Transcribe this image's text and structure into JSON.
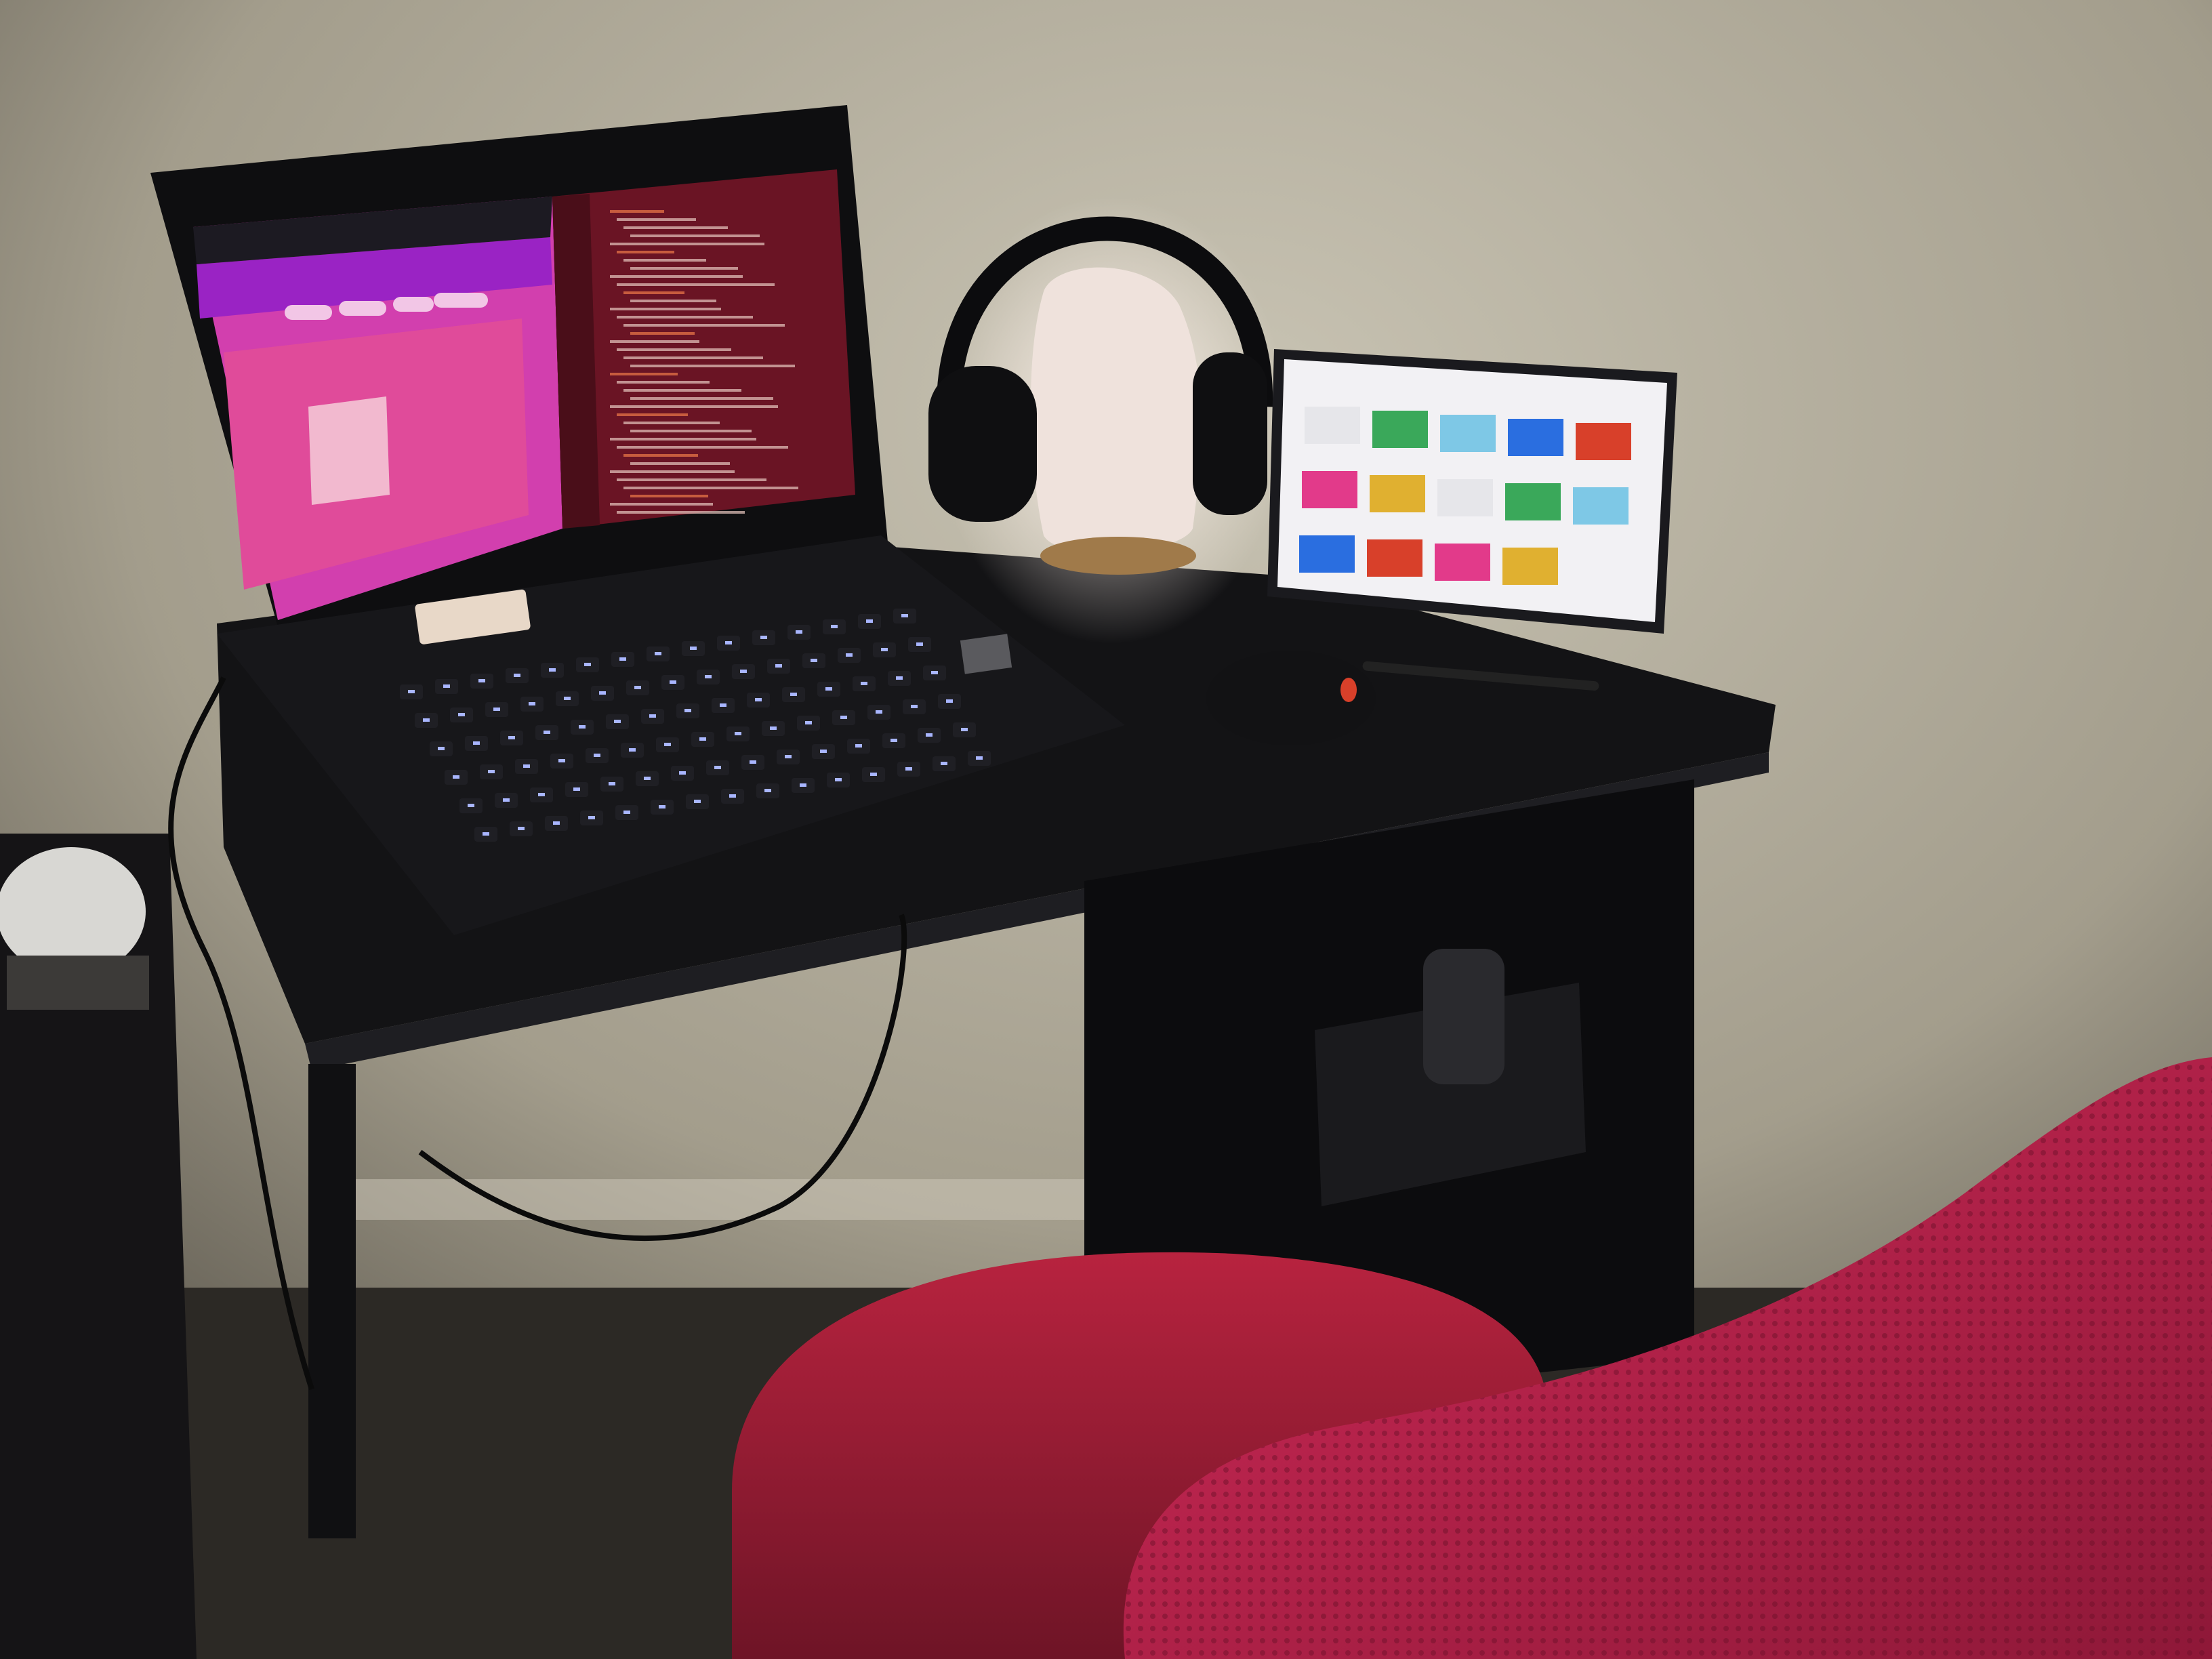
{
  "scene": {
    "description_free": true,
    "colors": {
      "wall": "#b9b3a3",
      "wall_shadow": "#5a554a",
      "desk": "#121214",
      "chair": "#c0244c",
      "browser_pink": "#d23fae",
      "browser_purple": "#9a23c4",
      "editor_red": "#6a1424",
      "tablet_screen": "#f2f1f4",
      "lamp": "#efe2dc"
    }
  },
  "laptop": {
    "sticker_text": "",
    "editor_lines": 38
  },
  "tablet": {
    "thumbnail_count": 14
  }
}
